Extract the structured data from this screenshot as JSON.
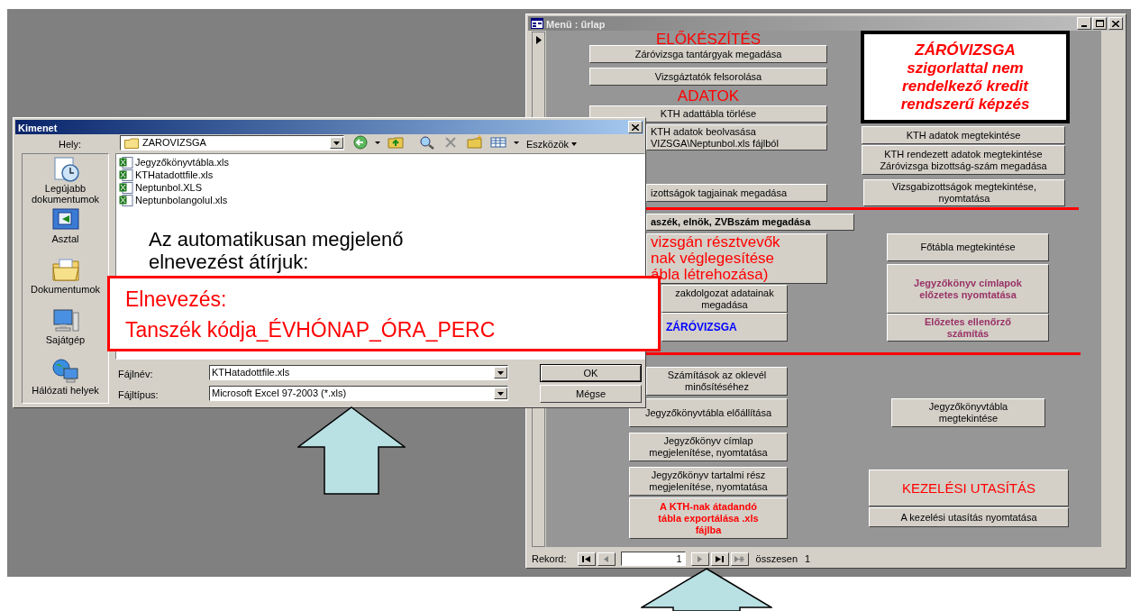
{
  "form_window": {
    "title": "Menü : űrlap",
    "headings": [
      "ELŐKÉSZÍTÉS",
      "ADATOK"
    ],
    "banner_lines": [
      "ZÁRÓVIZSGA",
      "szigorlattal nem",
      "rendelkező kredit",
      "rendszerű képzés"
    ],
    "buttons": [
      {
        "label": "Záróvizsga tantárgyak megadása",
        "kind": "normal"
      },
      {
        "label": "Vizsgáztatók felsorolása",
        "kind": "normal"
      },
      {
        "label": "KTH adattábla törlése",
        "kind": "normal"
      },
      {
        "label": "KTH adatok beolvasása\nVIZSGA\\Neptunbol.xls fájlból",
        "kind": "normal"
      },
      {
        "label": "KTH adatok megtekintése",
        "kind": "normal"
      },
      {
        "label": "KTH rendezett adatok megtekintése\nZáróvizsga bizottság-szám megadása",
        "kind": "normal"
      },
      {
        "label": "izottságok tagjainak megadása",
        "kind": "normal"
      },
      {
        "label": "Vizsgabizottságok megtekintése,\nnyomtatása",
        "kind": "normal"
      },
      {
        "label": "aszék, elnök, ZVBszám megadása",
        "kind": "bold"
      },
      {
        "label": "vizsgán résztvevők\nnak véglegesítése\nábla létrehozása)",
        "kind": "red_large"
      },
      {
        "label": "Főtábla megtekintése",
        "kind": "normal"
      },
      {
        "label": "Jegyzőkönyv címlapok\nelőzetes nyomtatása",
        "kind": "purple_bold"
      },
      {
        "label": "zakdolgozat adatainak\nmegadása",
        "kind": "normal"
      },
      {
        "label": "ZÁRÓVIZSGA",
        "kind": "blue_bold"
      },
      {
        "label": "Előzetes ellenőrző\nszámítás",
        "kind": "purple_bold"
      },
      {
        "label": "Számítások az oklevél\nminősítéséhez",
        "kind": "normal"
      },
      {
        "label": "Jegyzőkönyvtábla előállítása",
        "kind": "normal"
      },
      {
        "label": "Jegyzőkönyvtábla\nmegtekintése",
        "kind": "normal"
      },
      {
        "label": "Jegyzőkönyv címlap\nmegjelenítése, nyomtatása",
        "kind": "normal"
      },
      {
        "label": "Jegyzőkönyv tartalmi rész\nmegjelenítése, nyomtatása",
        "kind": "normal"
      },
      {
        "label": "A KTH-nak átadandó\ntábla exportálása  .xls\nfájlba",
        "kind": "red_bold"
      },
      {
        "label": "KEZELÉSI UTASÍTÁS",
        "kind": "red_title"
      },
      {
        "label": "A kezelési utasítás nyomtatása",
        "kind": "normal"
      }
    ],
    "record_bar": {
      "label": "Rekord:",
      "current": "1",
      "total_label": "összesen",
      "total": "1"
    }
  },
  "dialog": {
    "title": "Kimenet",
    "location_label": "Hely:",
    "location": "ZAROVIZSGA",
    "tools_menu": "Eszközök",
    "places": [
      "Legújabb\ndokumentumok",
      "Asztal",
      "Dokumentumok",
      "Sajátgép",
      "Hálózati helyek"
    ],
    "files": [
      "Jegyzőkönyvtábla.xls",
      "KTHatadottfile.xls",
      "Neptunbol.XLS",
      "Neptunbolangolul.xls"
    ],
    "file_name_label": "Fájlnév:",
    "file_name": "KTHatadottfile.xls",
    "file_type_label": "Fájltípus:",
    "file_type": "Microsoft Excel 97-2003 (*.xls)",
    "buttons": [
      "OK",
      "Mégse"
    ]
  },
  "annotation": {
    "note_lines": [
      "Az automatikusan megjelenő",
      "elnevezést átírjuk:"
    ],
    "box_lines": [
      "Elnevezés:",
      "Tanszék kódja_ÉVHÓNAP_ÓRA_PERC"
    ]
  }
}
